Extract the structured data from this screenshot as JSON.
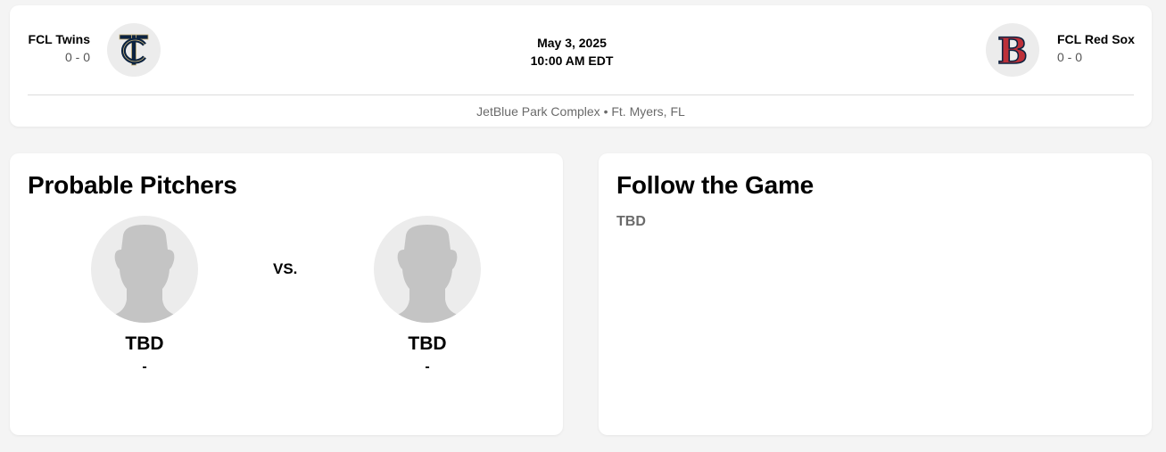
{
  "matchup": {
    "away": {
      "name": "FCL Twins",
      "record": "0 - 0",
      "logo_icon": "twins-tc-logo",
      "logo_colors": [
        "#0c2340",
        "#d31145"
      ]
    },
    "home": {
      "name": "FCL Red Sox",
      "record": "0 - 0",
      "logo_icon": "red-sox-b-logo",
      "logo_colors": [
        "#bd3039",
        "#0c2340"
      ]
    },
    "date": "May 3, 2025",
    "time": "10:00 AM EDT",
    "venue": "JetBlue Park Complex • Ft. Myers, FL"
  },
  "probable_pitchers": {
    "title": "Probable Pitchers",
    "vs_label": "VS.",
    "away": {
      "name": "TBD",
      "stat": "-",
      "image_icon": "player-silhouette-icon"
    },
    "home": {
      "name": "TBD",
      "stat": "-",
      "image_icon": "player-silhouette-icon"
    }
  },
  "follow_the_game": {
    "title": "Follow the Game",
    "value": "TBD"
  }
}
